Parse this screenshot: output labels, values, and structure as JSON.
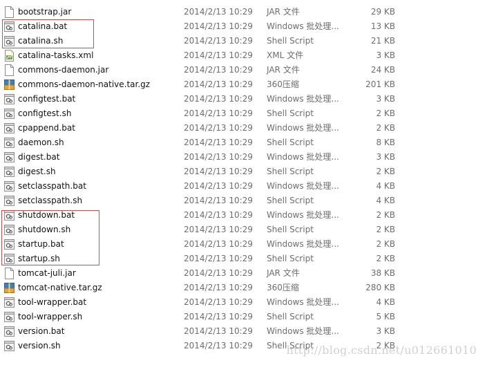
{
  "files": [
    {
      "name": "bootstrap.jar",
      "date": "2014/2/13 10:29",
      "type": "JAR 文件",
      "size": "29 KB",
      "icon": "jar-file-icon"
    },
    {
      "name": "catalina.bat",
      "date": "2014/2/13 10:29",
      "type": "Windows 批处理...",
      "size": "13 KB",
      "icon": "batch-file-icon"
    },
    {
      "name": "catalina.sh",
      "date": "2014/2/13 10:29",
      "type": "Shell Script",
      "size": "21 KB",
      "icon": "script-file-icon"
    },
    {
      "name": "catalina-tasks.xml",
      "date": "2014/2/13 10:29",
      "type": "XML 文件",
      "size": "3 KB",
      "icon": "xml-file-icon"
    },
    {
      "name": "commons-daemon.jar",
      "date": "2014/2/13 10:29",
      "type": "JAR 文件",
      "size": "24 KB",
      "icon": "jar-file-icon"
    },
    {
      "name": "commons-daemon-native.tar.gz",
      "date": "2014/2/13 10:29",
      "type": "360压缩",
      "size": "201 KB",
      "icon": "archive-file-icon"
    },
    {
      "name": "configtest.bat",
      "date": "2014/2/13 10:29",
      "type": "Windows 批处理...",
      "size": "3 KB",
      "icon": "batch-file-icon"
    },
    {
      "name": "configtest.sh",
      "date": "2014/2/13 10:29",
      "type": "Shell Script",
      "size": "2 KB",
      "icon": "script-file-icon"
    },
    {
      "name": "cpappend.bat",
      "date": "2014/2/13 10:29",
      "type": "Windows 批处理...",
      "size": "2 KB",
      "icon": "batch-file-icon"
    },
    {
      "name": "daemon.sh",
      "date": "2014/2/13 10:29",
      "type": "Shell Script",
      "size": "8 KB",
      "icon": "script-file-icon"
    },
    {
      "name": "digest.bat",
      "date": "2014/2/13 10:29",
      "type": "Windows 批处理...",
      "size": "3 KB",
      "icon": "batch-file-icon"
    },
    {
      "name": "digest.sh",
      "date": "2014/2/13 10:29",
      "type": "Shell Script",
      "size": "2 KB",
      "icon": "script-file-icon"
    },
    {
      "name": "setclasspath.bat",
      "date": "2014/2/13 10:29",
      "type": "Windows 批处理...",
      "size": "4 KB",
      "icon": "batch-file-icon"
    },
    {
      "name": "setclasspath.sh",
      "date": "2014/2/13 10:29",
      "type": "Shell Script",
      "size": "4 KB",
      "icon": "script-file-icon"
    },
    {
      "name": "shutdown.bat",
      "date": "2014/2/13 10:29",
      "type": "Windows 批处理...",
      "size": "2 KB",
      "icon": "batch-file-icon"
    },
    {
      "name": "shutdown.sh",
      "date": "2014/2/13 10:29",
      "type": "Shell Script",
      "size": "2 KB",
      "icon": "script-file-icon"
    },
    {
      "name": "startup.bat",
      "date": "2014/2/13 10:29",
      "type": "Windows 批处理...",
      "size": "2 KB",
      "icon": "batch-file-icon"
    },
    {
      "name": "startup.sh",
      "date": "2014/2/13 10:29",
      "type": "Shell Script",
      "size": "2 KB",
      "icon": "script-file-icon"
    },
    {
      "name": "tomcat-juli.jar",
      "date": "2014/2/13 10:29",
      "type": "JAR 文件",
      "size": "38 KB",
      "icon": "jar-file-icon"
    },
    {
      "name": "tomcat-native.tar.gz",
      "date": "2014/2/13 10:29",
      "type": "360压缩",
      "size": "280 KB",
      "icon": "archive-file-icon"
    },
    {
      "name": "tool-wrapper.bat",
      "date": "2014/2/13 10:29",
      "type": "Windows 批处理...",
      "size": "4 KB",
      "icon": "batch-file-icon"
    },
    {
      "name": "tool-wrapper.sh",
      "date": "2014/2/13 10:29",
      "type": "Shell Script",
      "size": "5 KB",
      "icon": "script-file-icon"
    },
    {
      "name": "version.bat",
      "date": "2014/2/13 10:29",
      "type": "Windows 批处理...",
      "size": "3 KB",
      "icon": "batch-file-icon"
    },
    {
      "name": "version.sh",
      "date": "2014/2/13 10:29",
      "type": "Shell Script",
      "size": "2 KB",
      "icon": "script-file-icon"
    }
  ],
  "watermark": "http://blog.csdn.net/u012661010",
  "colors": {
    "highlight_box": "#c0504d",
    "secondary_text": "#6d6d6d"
  }
}
